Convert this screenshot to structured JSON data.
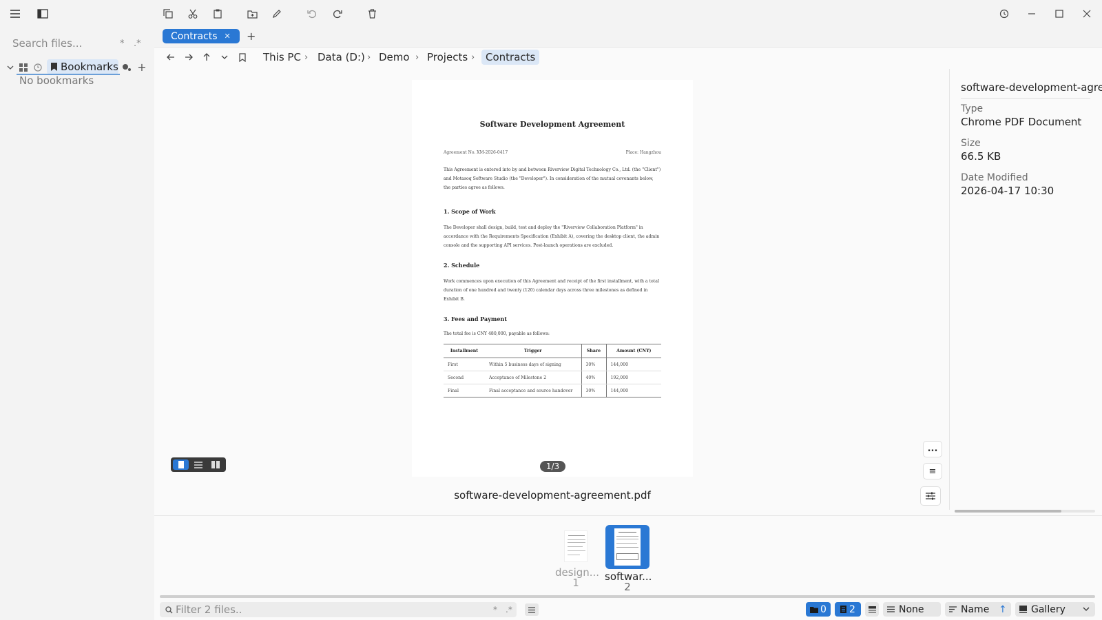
{
  "toolbar": {
    "icons": [
      "menu-icon",
      "sidebar-toggle-icon",
      "copy-icon",
      "cut-icon",
      "paste-icon",
      "new-folder-icon",
      "rename-icon",
      "undo-icon",
      "redo-icon",
      "delete-icon",
      "history-icon",
      "minimize-icon",
      "maximize-icon",
      "close-icon"
    ]
  },
  "sidebar": {
    "search_placeholder": "Search files...",
    "search_opt1": "*",
    "search_opt2": ".*",
    "bookmarks_label": "Bookmarks",
    "empty_text": "No bookmarks"
  },
  "tabs": [
    {
      "label": "Contracts",
      "close": "✕"
    }
  ],
  "add_tab": "+",
  "breadcrumb": [
    "This PC",
    "Data (D:)",
    "Demo",
    "Projects",
    "Contracts"
  ],
  "breadcrumb_sep": "›",
  "document": {
    "title": "Software Development Agreement",
    "agreement_no": "Agreement No. XM-2026-0417",
    "place": "Place: Hangzhou",
    "intro": "This Agreement is entered into by and between Riverview Digital Technology Co., Ltd. (the \"Client\") and Motasoq Software Studio (the \"Developer\"). In consideration of the mutual covenants below, the parties agree as follows.",
    "s1_title": "1. Scope of Work",
    "s1_text": "The Developer shall design, build, test and deploy the \"Riverview Collaboration Platform\" in accordance with the Requirements Specification (Exhibit A), covering the desktop client, the admin console and the supporting API services. Post-launch operations are excluded.",
    "s2_title": "2. Schedule",
    "s2_text": "Work commences upon execution of this Agreement and receipt of the first installment, with a total duration of one hundred and twenty (120) calendar days across three milestones as defined in Exhibit B.",
    "s3_title": "3. Fees and Payment",
    "s3_text": "The total fee is CNY 480,000, payable as follows:",
    "table_headers": [
      "Installment",
      "Trigger",
      "Share",
      "Amount (CNY)"
    ],
    "table_rows": [
      [
        "First",
        "Within 5 business days of signing",
        "30%",
        "144,000"
      ],
      [
        "Second",
        "Acceptance of Milestone 2",
        "40%",
        "192,000"
      ],
      [
        "Final",
        "Final acceptance and source handover",
        "30%",
        "144,000"
      ]
    ],
    "page_indicator": "1/3"
  },
  "preview_filename": "software-development-agreement.pdf",
  "side_buttons": [
    "...",
    "≡"
  ],
  "properties": {
    "name": "software-development-agreem",
    "type_label": "Type",
    "type_value": "Chrome PDF Document",
    "size_label": "Size",
    "size_value": "66.5 KB",
    "modified_label": "Date Modified",
    "modified_value": "2026-04-17 10:30"
  },
  "thumbnails": [
    {
      "name": "design...",
      "index": "1",
      "selected": false
    },
    {
      "name": "softwar...",
      "index": "2",
      "selected": true
    }
  ],
  "statusbar": {
    "filter_placeholder": "Filter 2 files..",
    "filter_opt1": "*",
    "filter_opt2": ".*",
    "folders_count": "0",
    "files_count": "2",
    "group_label": "None",
    "sort_label": "Name",
    "sort_dir": "↑",
    "view_label": "Gallery"
  },
  "colors": {
    "accent": "#2a78d4",
    "badge_dark": "#3a3a3a"
  }
}
